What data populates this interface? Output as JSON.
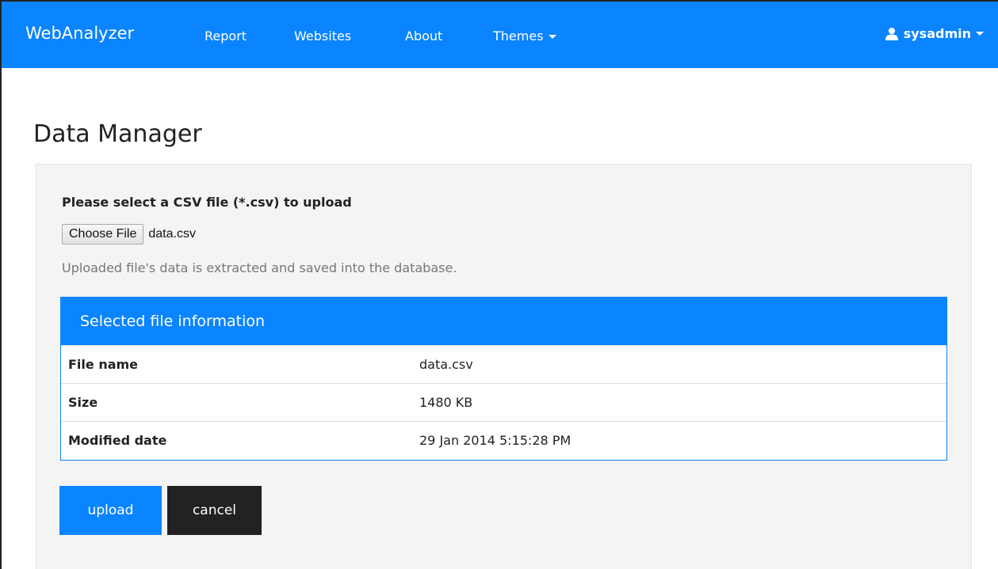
{
  "navbar": {
    "brand": "WebAnalyzer",
    "links": [
      {
        "label": "Report"
      },
      {
        "label": "Websites"
      },
      {
        "label": "About"
      },
      {
        "label": "Themes"
      }
    ],
    "user": "sysadmin"
  },
  "page": {
    "title": "Data Manager"
  },
  "upload": {
    "label": "Please select a CSV file (*.csv) to upload",
    "choose_button": "Choose File",
    "chosen_file": "data.csv",
    "help": "Uploaded file's data is extracted and saved into the database."
  },
  "file_info": {
    "heading": "Selected file information",
    "rows": [
      {
        "key": "File name",
        "value": "data.csv"
      },
      {
        "key": "Size",
        "value": "1480 KB"
      },
      {
        "key": "Modified date",
        "value": "29 Jan 2014 5:15:28 PM"
      }
    ]
  },
  "actions": {
    "upload": "upload",
    "cancel": "cancel"
  },
  "colors": {
    "primary": "#0a84ff",
    "dark": "#222222",
    "well": "#f4f4f4"
  }
}
